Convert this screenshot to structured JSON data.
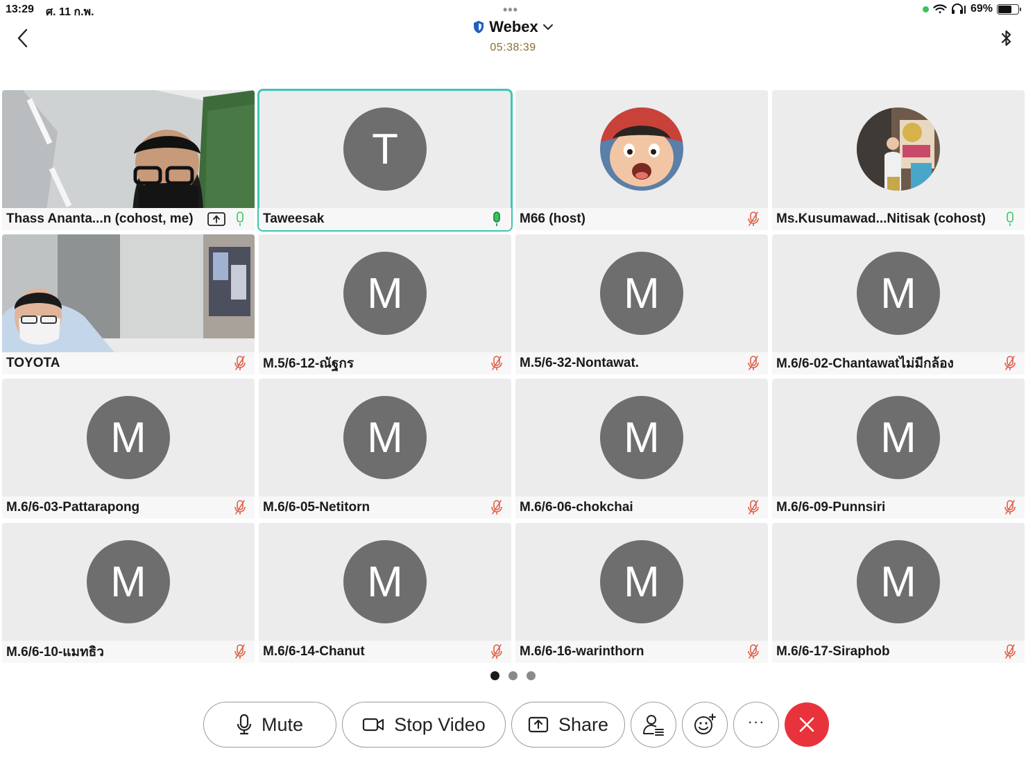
{
  "status": {
    "time": "13:29",
    "date": "ศ. 11 ก.พ.",
    "dots": "•••",
    "battery": "69%",
    "battery_level": 0.69
  },
  "header": {
    "title": "Webex",
    "timer": "05:38:39"
  },
  "participants": [
    {
      "name": "Thass Ananta...n (cohost, me)",
      "type": "video",
      "mic": "on"
    },
    {
      "name": "Taweesak",
      "type": "avatar",
      "initial": "T",
      "mic": "speaking",
      "active": true
    },
    {
      "name": "M66 (host)",
      "type": "photo",
      "mic": "muted"
    },
    {
      "name": "Ms.Kusumawad...Nitisak (cohost)",
      "type": "photo2",
      "mic": "on"
    },
    {
      "name": "TOYOTA",
      "type": "video2",
      "mic": "muted"
    },
    {
      "name": "M.5/6-12-ณัฐกร",
      "type": "avatar",
      "initial": "M",
      "mic": "muted"
    },
    {
      "name": "M.5/6-32-Nontawat.",
      "type": "avatar",
      "initial": "M",
      "mic": "muted"
    },
    {
      "name": "M.6/6-02-Chantawatไม่มีกล้อง",
      "type": "avatar",
      "initial": "M",
      "mic": "muted"
    },
    {
      "name": "M.6/6-03-Pattarapong",
      "type": "avatar",
      "initial": "M",
      "mic": "muted"
    },
    {
      "name": "M.6/6-05-Netitorn",
      "type": "avatar",
      "initial": "M",
      "mic": "muted"
    },
    {
      "name": "M.6/6-06-chokchai",
      "type": "avatar",
      "initial": "M",
      "mic": "muted"
    },
    {
      "name": "M.6/6-09-Punnsiri",
      "type": "avatar",
      "initial": "M",
      "mic": "muted"
    },
    {
      "name": "M.6/6-10-แมทธิว",
      "type": "avatar",
      "initial": "M",
      "mic": "muted"
    },
    {
      "name": "M.6/6-14-Chanut",
      "type": "avatar",
      "initial": "M",
      "mic": "muted"
    },
    {
      "name": "M.6/6-16-warinthorn",
      "type": "avatar",
      "initial": "M",
      "mic": "muted"
    },
    {
      "name": "M.6/6-17-Siraphob",
      "type": "avatar",
      "initial": "M",
      "mic": "muted"
    }
  ],
  "pagination": {
    "count": 3,
    "current": 0
  },
  "toolbar": {
    "mute_label": "Mute",
    "stop_video_label": "Stop Video",
    "share_label": "Share",
    "participants_icon": "participants-icon",
    "reactions_icon": "reactions-icon",
    "more_label": "···",
    "end_icon": "close-icon"
  },
  "colors": {
    "active_border": "#3cc6b5",
    "muted_red": "#e25b45",
    "mic_green": "#34c759",
    "end_red": "#e8333c",
    "avatar_gray": "#6e6e6e",
    "timer": "#8a6d2e"
  }
}
